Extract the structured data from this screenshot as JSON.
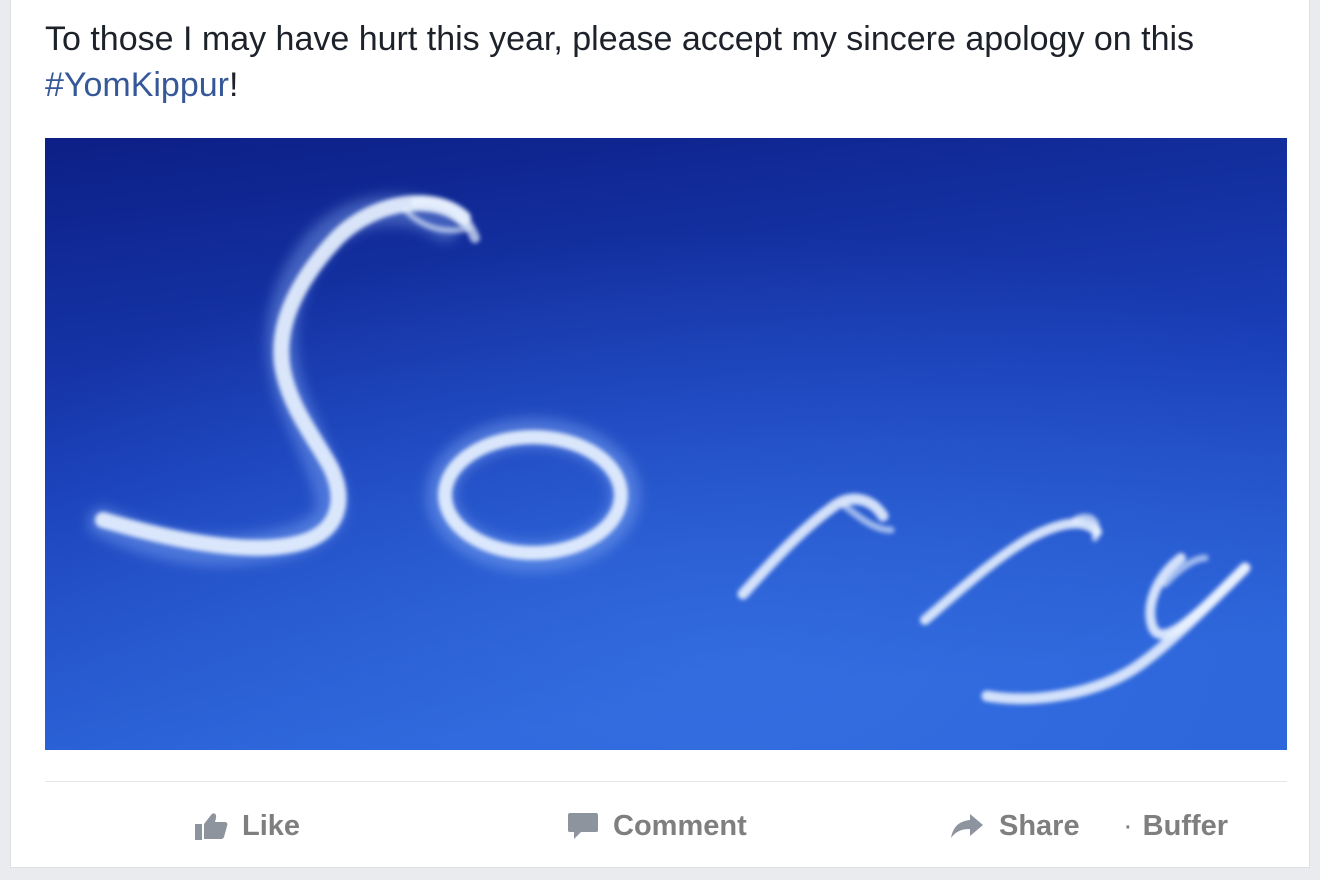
{
  "post": {
    "text": "To those I may have hurt this year, please accept my sincere apology on this ",
    "hashtag": "#YomKippur",
    "text_end": "!",
    "image": {
      "icon": "skywriting-sorry-photo",
      "alt_text": "Sorry",
      "sky_color_top": "#0c1f86",
      "sky_color_bottom": "#2b62d8",
      "smoke_color": "#e9f2ff"
    }
  },
  "actions": {
    "like": {
      "label": "Like",
      "icon": "thumbs-up-icon"
    },
    "comment": {
      "label": "Comment",
      "icon": "speech-bubble-icon"
    },
    "share": {
      "label": "Share",
      "icon": "share-arrow-icon"
    },
    "separator": "·",
    "buffer": {
      "label": "Buffer"
    },
    "color": "#7f7f7f"
  }
}
